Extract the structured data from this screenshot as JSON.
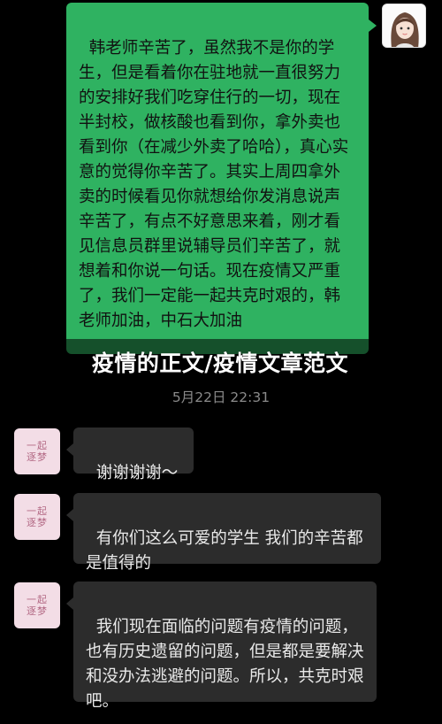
{
  "chat": {
    "my_message": "韩老师辛苦了，虽然我不是你的学生，但是看着你在驻地就一直很努力的安排好我们吃穿住行的一切，现在半封校，做核酸也看到你，拿外卖也看到你（在减少外卖了哈哈），真心实意的觉得你辛苦了。其实上周四拿外卖的时候看见你就想给你发消息说声辛苦了，有点不好意思来着，刚才看见信息员群里说辅导员们辛苦了，就想着和你说一句话。现在疫情又严重了，我们一定能一起共克时艰的，韩老师加油，中石大加油",
    "timestamp": "5月22日 22:31",
    "replies": [
      "谢谢谢谢～",
      "有你们这么可爱的学生 我们的辛苦都是值得的",
      "我们现在面临的问题有疫情的问题，也有历史遗留的问题，但是都是要解决和没办法逃避的问题。所以，共克时艰吧。"
    ],
    "contact_seal": "一起\n逐梦"
  },
  "overlay": {
    "title": "疫情的正文/疫情文章范文"
  },
  "colors": {
    "background": "#000000",
    "my_bubble": "#2fb261",
    "their_bubble": "#2c2c2c"
  }
}
